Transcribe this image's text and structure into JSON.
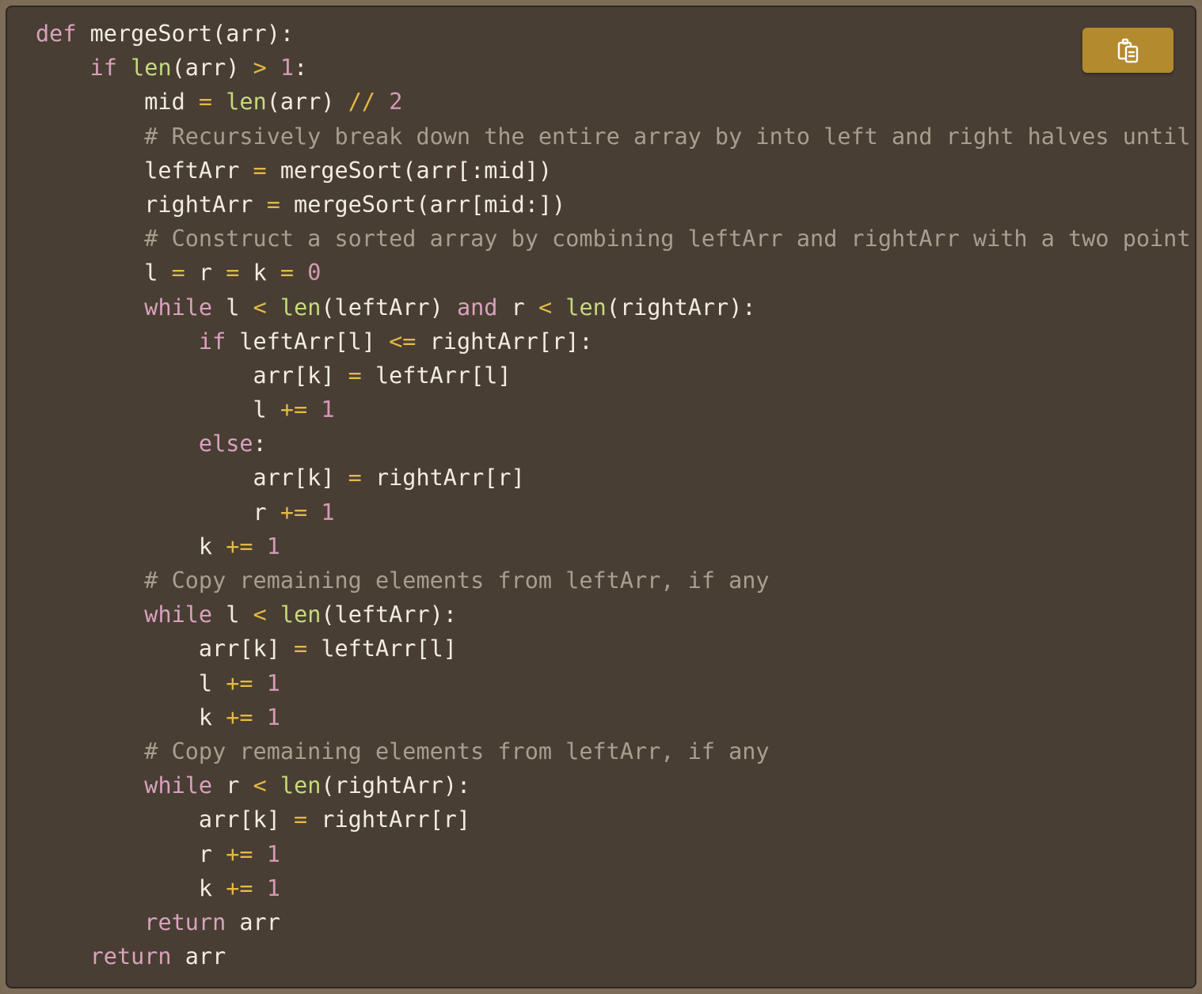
{
  "window": {
    "copy_button": {
      "icon": "clipboard-icon",
      "color": "#b48a2e"
    }
  },
  "colors": {
    "background": "#483e34",
    "keyword": "#d9a2bd",
    "builtin": "#c6da7c",
    "operator": "#e3b944",
    "number": "#d59ab4",
    "comment": "#a79f8f",
    "text": "#f2ece2"
  },
  "code": {
    "language": "python",
    "lines": [
      [
        [
          "kw",
          "def"
        ],
        [
          "id",
          " mergeSort(arr):"
        ]
      ],
      [
        [
          "id",
          "    "
        ],
        [
          "kw",
          "if"
        ],
        [
          "id",
          " "
        ],
        [
          "fn",
          "len"
        ],
        [
          "id",
          "(arr) "
        ],
        [
          "op",
          ">"
        ],
        [
          "id",
          " "
        ],
        [
          "num",
          "1"
        ],
        [
          "id",
          ":"
        ]
      ],
      [
        [
          "id",
          "        mid "
        ],
        [
          "op",
          "="
        ],
        [
          "id",
          " "
        ],
        [
          "fn",
          "len"
        ],
        [
          "id",
          "(arr) "
        ],
        [
          "op",
          "//"
        ],
        [
          "id",
          " "
        ],
        [
          "num",
          "2"
        ]
      ],
      [
        [
          "id",
          "        "
        ],
        [
          "cm",
          "# Recursively break down the entire array by into left and right halves until"
        ]
      ],
      [
        [
          "id",
          "        leftArr "
        ],
        [
          "op",
          "="
        ],
        [
          "id",
          " mergeSort(arr[:mid])"
        ]
      ],
      [
        [
          "id",
          "        rightArr "
        ],
        [
          "op",
          "="
        ],
        [
          "id",
          " mergeSort(arr[mid:])"
        ]
      ],
      [
        [
          "id",
          "        "
        ],
        [
          "cm",
          "# Construct a sorted array by combining leftArr and rightArr with a two point"
        ]
      ],
      [
        [
          "id",
          "        l "
        ],
        [
          "op",
          "="
        ],
        [
          "id",
          " r "
        ],
        [
          "op",
          "="
        ],
        [
          "id",
          " k "
        ],
        [
          "op",
          "="
        ],
        [
          "id",
          " "
        ],
        [
          "num",
          "0"
        ]
      ],
      [
        [
          "id",
          "        "
        ],
        [
          "kw",
          "while"
        ],
        [
          "id",
          " l "
        ],
        [
          "op",
          "<"
        ],
        [
          "id",
          " "
        ],
        [
          "fn",
          "len"
        ],
        [
          "id",
          "(leftArr) "
        ],
        [
          "kw",
          "and"
        ],
        [
          "id",
          " r "
        ],
        [
          "op",
          "<"
        ],
        [
          "id",
          " "
        ],
        [
          "fn",
          "len"
        ],
        [
          "id",
          "(rightArr):"
        ]
      ],
      [
        [
          "id",
          "            "
        ],
        [
          "kw",
          "if"
        ],
        [
          "id",
          " leftArr[l] "
        ],
        [
          "op",
          "<="
        ],
        [
          "id",
          " rightArr[r]:"
        ]
      ],
      [
        [
          "id",
          "                arr[k] "
        ],
        [
          "op",
          "="
        ],
        [
          "id",
          " leftArr[l]"
        ]
      ],
      [
        [
          "id",
          "                l "
        ],
        [
          "op",
          "+="
        ],
        [
          "id",
          " "
        ],
        [
          "num",
          "1"
        ]
      ],
      [
        [
          "id",
          "            "
        ],
        [
          "kw",
          "else"
        ],
        [
          "id",
          ":"
        ]
      ],
      [
        [
          "id",
          "                arr[k] "
        ],
        [
          "op",
          "="
        ],
        [
          "id",
          " rightArr[r]"
        ]
      ],
      [
        [
          "id",
          "                r "
        ],
        [
          "op",
          "+="
        ],
        [
          "id",
          " "
        ],
        [
          "num",
          "1"
        ]
      ],
      [
        [
          "id",
          "            k "
        ],
        [
          "op",
          "+="
        ],
        [
          "id",
          " "
        ],
        [
          "num",
          "1"
        ]
      ],
      [
        [
          "id",
          "        "
        ],
        [
          "cm",
          "# Copy remaining elements from leftArr, if any"
        ]
      ],
      [
        [
          "id",
          "        "
        ],
        [
          "kw",
          "while"
        ],
        [
          "id",
          " l "
        ],
        [
          "op",
          "<"
        ],
        [
          "id",
          " "
        ],
        [
          "fn",
          "len"
        ],
        [
          "id",
          "(leftArr):"
        ]
      ],
      [
        [
          "id",
          "            arr[k] "
        ],
        [
          "op",
          "="
        ],
        [
          "id",
          " leftArr[l]"
        ]
      ],
      [
        [
          "id",
          "            l "
        ],
        [
          "op",
          "+="
        ],
        [
          "id",
          " "
        ],
        [
          "num",
          "1"
        ]
      ],
      [
        [
          "id",
          "            k "
        ],
        [
          "op",
          "+="
        ],
        [
          "id",
          " "
        ],
        [
          "num",
          "1"
        ]
      ],
      [
        [
          "id",
          "        "
        ],
        [
          "cm",
          "# Copy remaining elements from leftArr, if any"
        ]
      ],
      [
        [
          "id",
          "        "
        ],
        [
          "kw",
          "while"
        ],
        [
          "id",
          " r "
        ],
        [
          "op",
          "<"
        ],
        [
          "id",
          " "
        ],
        [
          "fn",
          "len"
        ],
        [
          "id",
          "(rightArr):"
        ]
      ],
      [
        [
          "id",
          "            arr[k] "
        ],
        [
          "op",
          "="
        ],
        [
          "id",
          " rightArr[r]"
        ]
      ],
      [
        [
          "id",
          "            r "
        ],
        [
          "op",
          "+="
        ],
        [
          "id",
          " "
        ],
        [
          "num",
          "1"
        ]
      ],
      [
        [
          "id",
          "            k "
        ],
        [
          "op",
          "+="
        ],
        [
          "id",
          " "
        ],
        [
          "num",
          "1"
        ]
      ],
      [
        [
          "id",
          "        "
        ],
        [
          "kw",
          "return"
        ],
        [
          "id",
          " arr"
        ]
      ],
      [
        [
          "id",
          "    "
        ],
        [
          "kw",
          "return"
        ],
        [
          "id",
          " arr"
        ]
      ]
    ]
  }
}
